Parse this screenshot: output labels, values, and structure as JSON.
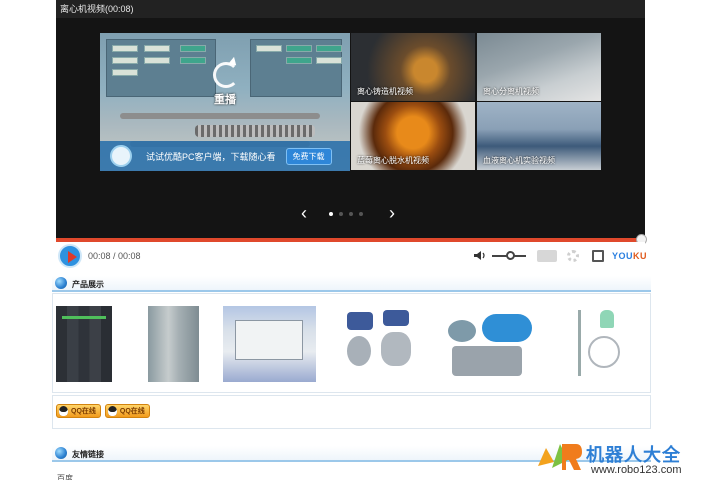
{
  "player": {
    "title": "离心机视频(00:08)",
    "replay_label": "重播",
    "pc_banner_text": "试试优酷PC客户端，下载随心看",
    "pc_banner_button": "免费下载",
    "related": [
      {
        "caption": "离心铸造机视频",
        "icon": "play-thumb"
      },
      {
        "caption": "离心分离机视频",
        "icon": "play-thumb"
      },
      {
        "caption": "蓝莓离心脱水机视频",
        "icon": "play-thumb"
      },
      {
        "caption": "血液离心机实验视频",
        "icon": "play-thumb"
      }
    ],
    "carousel": {
      "prev": "‹",
      "next": "›",
      "page_count": 4,
      "active_page": 1
    },
    "progress": 1.0,
    "time": "00:08 / 00:08",
    "brand": {
      "you": "YOU",
      "ku": "KU"
    },
    "colors": {
      "progress": "#e0492c",
      "play_button": "#2e92e0"
    }
  },
  "products": {
    "heading": "产品展示",
    "items": [
      {
        "name": "plc-module"
      },
      {
        "name": "electrical-cabinet"
      },
      {
        "name": "controller-box"
      },
      {
        "name": "control-valve"
      },
      {
        "name": "pressure-transmitter"
      },
      {
        "name": "level-gauge"
      }
    ],
    "qq_buttons": [
      "QQ在线",
      "QQ在线"
    ]
  },
  "links": {
    "heading": "友情链接",
    "items": [
      "百度"
    ]
  },
  "watermark": {
    "brand": "机器人大全",
    "url": "www.robo123.com"
  }
}
